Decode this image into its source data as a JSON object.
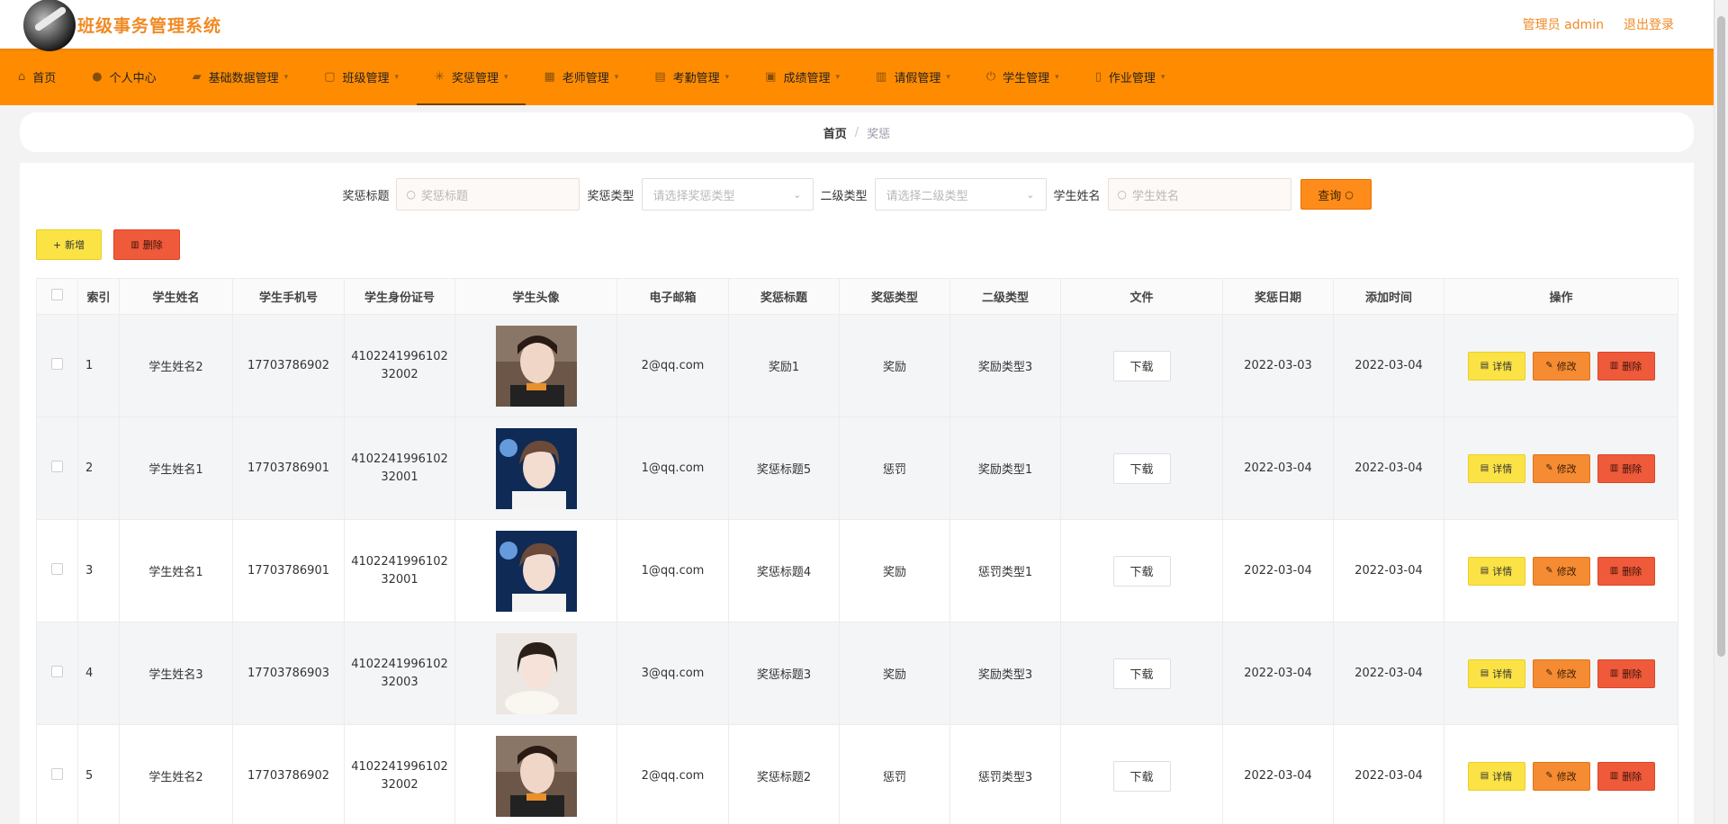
{
  "header": {
    "title": "班级事务管理系统",
    "user": "管理员 admin",
    "logout": "退出登录"
  },
  "nav": {
    "items": [
      {
        "label": "首页",
        "icon": "home-icon"
      },
      {
        "label": "个人中心",
        "icon": "user-icon"
      },
      {
        "label": "基础数据管理",
        "icon": "data-icon"
      },
      {
        "label": "班级管理",
        "icon": "class-icon"
      },
      {
        "label": "奖惩管理",
        "icon": "award-icon"
      },
      {
        "label": "老师管理",
        "icon": "grid-icon"
      },
      {
        "label": "考勤管理",
        "icon": "calendar-icon"
      },
      {
        "label": "成绩管理",
        "icon": "briefcase-icon"
      },
      {
        "label": "请假管理",
        "icon": "table-icon"
      },
      {
        "label": "学生管理",
        "icon": "power-icon"
      },
      {
        "label": "作业管理",
        "icon": "phone-icon"
      }
    ],
    "active_index": 4
  },
  "breadcrumb": {
    "home": "首页",
    "separator": "/",
    "current": "奖惩"
  },
  "search": {
    "title_label": "奖惩标题",
    "title_placeholder": "奖惩标题",
    "type_label": "奖惩类型",
    "type_placeholder": "请选择奖惩类型",
    "subtype_label": "二级类型",
    "subtype_placeholder": "请选择二级类型",
    "name_label": "学生姓名",
    "name_placeholder": "学生姓名",
    "query_label": "查询"
  },
  "actions": {
    "add_label": "新增",
    "delete_label": "删除"
  },
  "table": {
    "columns": [
      "索引",
      "学生姓名",
      "学生手机号",
      "学生身份证号",
      "学生头像",
      "电子邮箱",
      "奖惩标题",
      "奖惩类型",
      "二级类型",
      "文件",
      "奖惩日期",
      "添加时间",
      "操作"
    ],
    "download_label": "下载",
    "detail_label": "详情",
    "edit_label": "修改",
    "remove_label": "删除",
    "rows": [
      {
        "index": "1",
        "name": "学生姓名2",
        "phone": "17703786902",
        "id_line1": "4102241996102",
        "id_line2": "32002",
        "email": "2@qq.com",
        "title": "奖励1",
        "type": "奖励",
        "subtype": "奖励类型3",
        "date": "2022-03-03",
        "added": "2022-03-04"
      },
      {
        "index": "2",
        "name": "学生姓名1",
        "phone": "17703786901",
        "id_line1": "4102241996102",
        "id_line2": "32001",
        "email": "1@qq.com",
        "title": "奖惩标题5",
        "type": "惩罚",
        "subtype": "奖励类型1",
        "date": "2022-03-04",
        "added": "2022-03-04"
      },
      {
        "index": "3",
        "name": "学生姓名1",
        "phone": "17703786901",
        "id_line1": "4102241996102",
        "id_line2": "32001",
        "email": "1@qq.com",
        "title": "奖惩标题4",
        "type": "奖励",
        "subtype": "惩罚类型1",
        "date": "2022-03-04",
        "added": "2022-03-04"
      },
      {
        "index": "4",
        "name": "学生姓名3",
        "phone": "17703786903",
        "id_line1": "4102241996102",
        "id_line2": "32003",
        "email": "3@qq.com",
        "title": "奖惩标题3",
        "type": "奖励",
        "subtype": "奖励类型3",
        "date": "2022-03-04",
        "added": "2022-03-04"
      },
      {
        "index": "5",
        "name": "学生姓名2",
        "phone": "17703786902",
        "id_line1": "4102241996102",
        "id_line2": "32002",
        "email": "2@qq.com",
        "title": "奖惩标题2",
        "type": "惩罚",
        "subtype": "惩罚类型3",
        "date": "2022-03-04",
        "added": "2022-03-04"
      }
    ]
  },
  "colors": {
    "brand": "#f08a24",
    "nav_bg": "#ff8c00",
    "detail_btn": "#fbe345",
    "edit_btn": "#f58b32",
    "remove_btn": "#ee5a3a"
  }
}
